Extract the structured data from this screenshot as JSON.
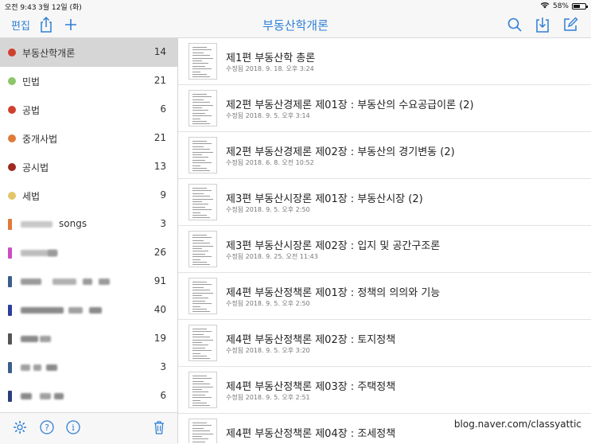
{
  "status": {
    "time": "오전 9:43",
    "date": "3월 12일 (화)",
    "battery": "58%",
    "battery_level": 0.58
  },
  "nav": {
    "edit_label": "편집",
    "title": "부동산학개론"
  },
  "colors": {
    "accent": "#2f7fd6"
  },
  "sidebar": {
    "items": [
      {
        "label": "부동산학개론",
        "count": "14",
        "color": "#d0402f",
        "marker": "dot",
        "selected": true
      },
      {
        "label": "민법",
        "count": "21",
        "color": "#8dc66a",
        "marker": "dot"
      },
      {
        "label": "공법",
        "count": "6",
        "color": "#d0402f",
        "marker": "dot"
      },
      {
        "label": "중개사법",
        "count": "21",
        "color": "#e07a3a",
        "marker": "dot"
      },
      {
        "label": "공시법",
        "count": "13",
        "color": "#9e2a22",
        "marker": "dot"
      },
      {
        "label": "세법",
        "count": "9",
        "color": "#e3c66a",
        "marker": "dot"
      },
      {
        "label": "songs",
        "count": "3",
        "color": "#e07a3a",
        "marker": "bar"
      },
      {
        "label": "",
        "count": "26",
        "color": "#c94fc4",
        "marker": "bar"
      },
      {
        "label": "",
        "count": "91",
        "color": "#3b5e8c",
        "marker": "bar"
      },
      {
        "label": "",
        "count": "40",
        "color": "#2c3e9a",
        "marker": "bar"
      },
      {
        "label": "",
        "count": "19",
        "color": "#555555",
        "marker": "bar"
      },
      {
        "label": "",
        "count": "3",
        "color": "#3b5e8c",
        "marker": "bar"
      },
      {
        "label": "",
        "count": "6",
        "color": "#2c3e7a",
        "marker": "bar"
      }
    ],
    "footer_icons": [
      "gear-icon",
      "help-icon",
      "info-icon",
      "trash-icon"
    ]
  },
  "list": {
    "rows": [
      {
        "title": "제1편 부동산학 총론",
        "subtitle": "수정됨 2018. 9. 18. 오후 3:24"
      },
      {
        "title": "제2편 부동산경제론 제01장 : 부동산의 수요공급이론 (2)",
        "subtitle": "수정됨 2018. 9. 5. 오후 3:14"
      },
      {
        "title": "제2편 부동산경제론 제02장 : 부동산의 경기변동 (2)",
        "subtitle": "수정됨 2018. 6. 8. 오전 10:52"
      },
      {
        "title": "제3편 부동산시장론 제01장 : 부동산시장 (2)",
        "subtitle": "수정됨 2018. 9. 5. 오후 2:50"
      },
      {
        "title": "제3편 부동산시장론 제02장 : 입지 및 공간구조론",
        "subtitle": "수정됨 2018. 9. 25. 오전 11:43"
      },
      {
        "title": "제4편 부동산정책론 제01장 : 정책의 의의와 기능",
        "subtitle": "수정됨 2018. 9. 5. 오후 2:50"
      },
      {
        "title": "제4편 부동산정책론 제02장 : 토지정책",
        "subtitle": "수정됨 2018. 9. 5. 오후 3:20"
      },
      {
        "title": "제4편 부동산정책론 제03장 : 주택정책",
        "subtitle": "수정됨 2018. 9. 5. 오후 2:51"
      },
      {
        "title": "제4편 부동산정책론 제04장 : 조세정책",
        "subtitle": ""
      }
    ]
  },
  "watermark": "blog.naver.com/classyattic"
}
